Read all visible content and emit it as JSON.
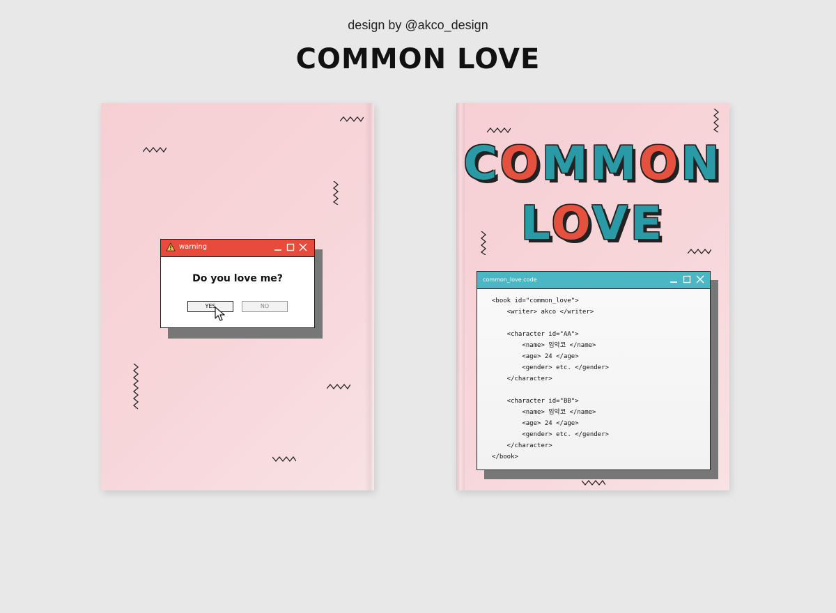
{
  "header": {
    "credit": "design by @akco_design",
    "title": "COMMON LOVE"
  },
  "back_cover": {
    "dialog": {
      "title": "warning",
      "question": "Do you love me?",
      "yes_label": "YES",
      "no_label": "NO"
    }
  },
  "front_cover": {
    "title_line1": [
      "C",
      "O",
      "M",
      "M",
      "O",
      "N"
    ],
    "title_line2": [
      "L",
      "O",
      "V",
      "E"
    ],
    "letter_colors": {
      "teal": "#2a9ba6",
      "red": "#e5503f"
    },
    "code_window": {
      "title": "common_love.code",
      "lines": [
        "<book id=\"common_love\">",
        "    <writer> akco </writer>",
        "",
        "    <character id=\"AA\">",
        "        <name> 임악코 </name>",
        "        <age> 24 </age>",
        "        <gender> etc. </gender>",
        "    </character>",
        "",
        "    <character id=\"BB\">",
        "        <name> 임악코 </name>",
        "        <age> 24 </age>",
        "        <gender> etc. </gender>",
        "    </character>",
        "</book>"
      ]
    }
  },
  "colors": {
    "cover_pink": "#f6cfd3",
    "dialog_bar": "#e84a3c",
    "code_bar": "#4bb6c4"
  }
}
